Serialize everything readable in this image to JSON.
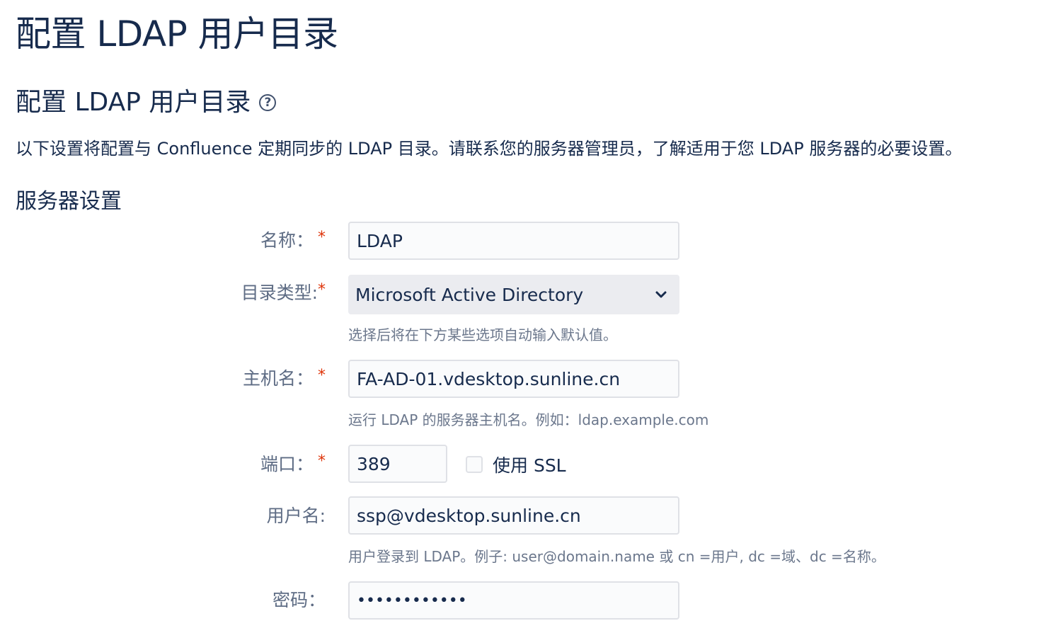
{
  "page": {
    "title": "配置 LDAP 用户目录"
  },
  "section": {
    "title": "配置 LDAP 用户目录",
    "help_icon": "question-circle-icon",
    "intro": "以下设置将配置与 Confluence 定期同步的 LDAP 目录。请联系您的服务器管理员，了解适用于您 LDAP 服务器的必要设置。"
  },
  "server_settings": {
    "title": "服务器设置",
    "name": {
      "label": "名称：",
      "required": "*",
      "value": "LDAP"
    },
    "directory_type": {
      "label": "目录类型:",
      "required": "*",
      "selected": "Microsoft Active Directory",
      "hint": "选择后将在下方某些选项自动输入默认值。"
    },
    "hostname": {
      "label": "主机名：",
      "required": "*",
      "value": "FA-AD-01.vdesktop.sunline.cn",
      "hint": "运行 LDAP 的服务器主机名。例如：ldap.example.com"
    },
    "port": {
      "label": "端口：",
      "required": "*",
      "value": "389",
      "use_ssl_label": "使用 SSL",
      "use_ssl_checked": false
    },
    "username": {
      "label": "用户名:",
      "value": "ssp@vdesktop.sunline.cn",
      "hint": "用户登录到 LDAP。例子: user@domain.name 或 cn =用户, dc =域、dc =名称。"
    },
    "password": {
      "label": "密码：",
      "masked_value": "••••••••••••"
    }
  }
}
